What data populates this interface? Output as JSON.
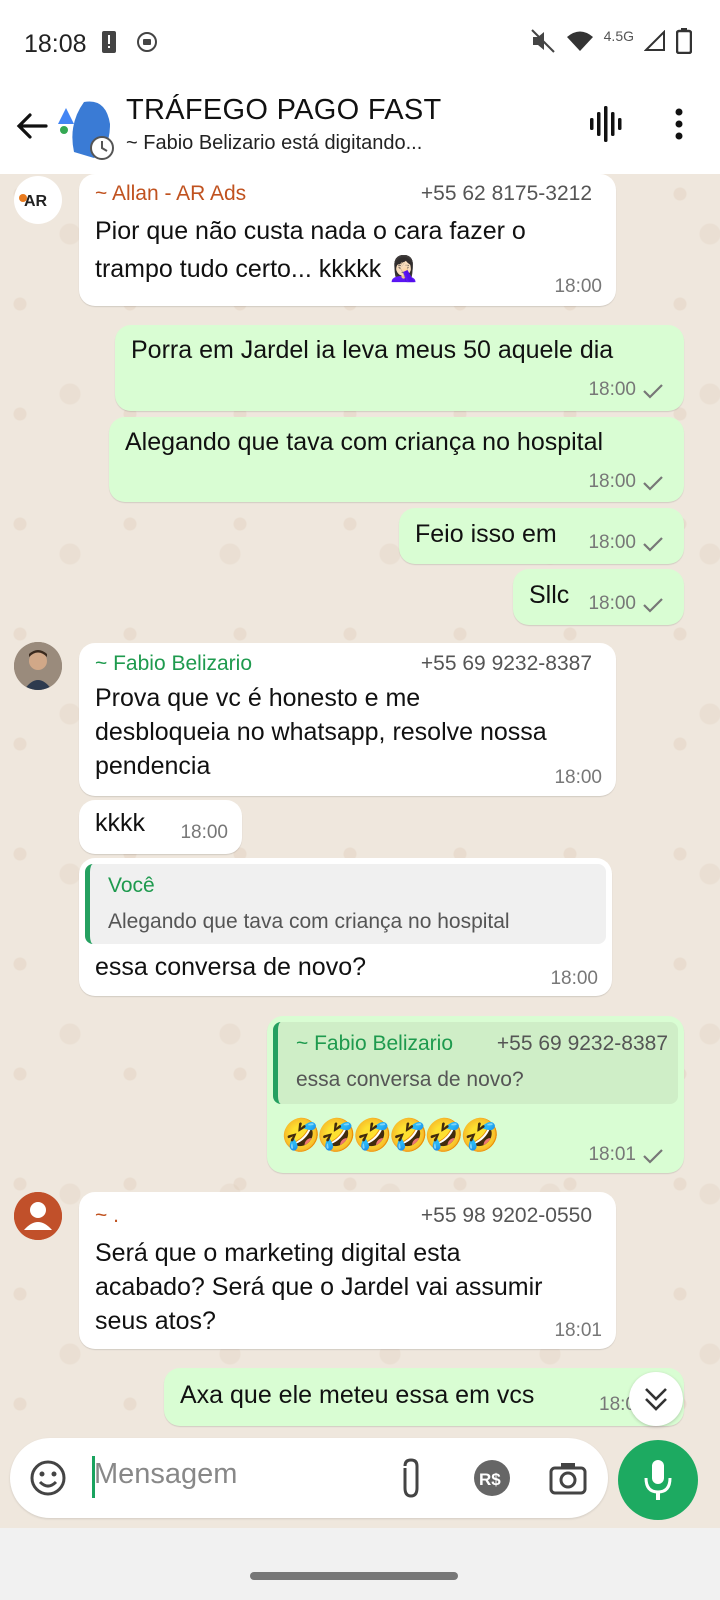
{
  "status_bar": {
    "time": "18:08",
    "network": "4.5G"
  },
  "header": {
    "title": "TRÁFEGO PAGO FAST",
    "subtitle": "~ Fabio Belizario está digitando..."
  },
  "messages": [
    {
      "sender": "~ Allan - AR Ads",
      "sender_color": "#c0521f",
      "phone": "+55 62 8175-3212",
      "text1": "Pior que não custa nada o cara fazer o",
      "text2": "trampo tudo certo... kkkkk 🤦🏻‍♀️",
      "time": "18:00",
      "avatar_text": "AR"
    },
    {
      "text": "Porra em Jardel ia leva meus 50 aquele dia",
      "time": "18:00"
    },
    {
      "text": "Alegando que tava com criança no hospital",
      "time": "18:00"
    },
    {
      "text": "Feio isso em",
      "time": "18:00"
    },
    {
      "text": "Sllc",
      "time": "18:00"
    },
    {
      "sender": "~ Fabio Belizario",
      "sender_color": "#1e9a4e",
      "phone": "+55 69 9232-8387",
      "text1": "Prova que vc é honesto e me",
      "text2": "desbloqueia no whatsapp, resolve nossa",
      "text3": "pendencia",
      "time": "18:00"
    },
    {
      "text": "kkkk",
      "time": "18:00"
    },
    {
      "quote_author": "Você",
      "quote_text": "Alegando que tava com criança no hospital",
      "text": "essa conversa de novo?",
      "time": "18:00"
    },
    {
      "quote_author": "~ Fabio Belizario",
      "quote_phone": "+55 69 9232-8387",
      "quote_text": "essa conversa de novo?",
      "text": "🤣🤣🤣🤣🤣🤣",
      "time": "18:01"
    },
    {
      "sender": "~ .",
      "sender_color": "#c0521f",
      "phone": "+55 98 9202-0550",
      "text1": "Será que o marketing digital esta",
      "text2": "acabado? Será que o Jardel vai assumir",
      "text3": "seus atos?",
      "time": "18:01"
    },
    {
      "text": "Axa que ele meteu essa em vcs",
      "time": "18:0"
    }
  ],
  "input": {
    "placeholder": "Mensagem"
  },
  "colors": {
    "accent": "#1daa61",
    "outgoing": "#d9fdd3",
    "incoming": "#ffffff"
  }
}
